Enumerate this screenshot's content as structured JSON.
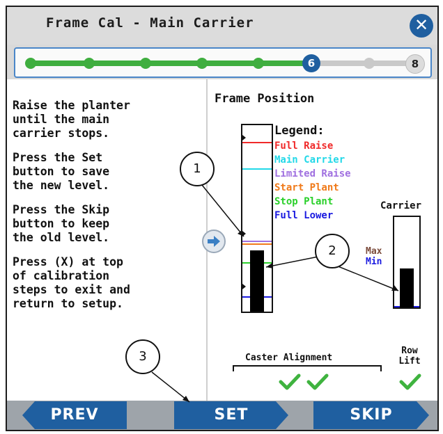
{
  "header": {
    "title": "Frame Cal - Main Carrier",
    "close_icon": "close-icon"
  },
  "progress": {
    "completed_steps": 5,
    "current_step": "6",
    "last_step": "8"
  },
  "instructions": [
    "Raise the planter\nuntil the main\ncarrier stops.",
    "Press the Set\nbutton to save\nthe new level.",
    "Press the Skip\nbutton to keep\nthe old level.",
    "Press (X) at top\nof calibration\nsteps to exit and\nreturn to setup."
  ],
  "frame_position": {
    "title": "Frame Position",
    "legend_title": "Legend:",
    "legend": [
      {
        "label": "Full Raise",
        "color": "#f02a2a"
      },
      {
        "label": "Main Carrier",
        "color": "#22d8e8"
      },
      {
        "label": "Limited Raise",
        "color": "#a070e0"
      },
      {
        "label": "Start Plant",
        "color": "#f07a1a"
      },
      {
        "label": "Stop Plant",
        "color": "#2ad02a"
      },
      {
        "label": "Full Lower",
        "color": "#1a1ae0"
      }
    ],
    "fill_fraction": 0.33
  },
  "carrier": {
    "label": "Carrier",
    "max_label": "Max",
    "min_label": "Min",
    "fill_fraction": 0.43
  },
  "status": {
    "caster_alignment_label": "Caster Alignment",
    "row_lift_label": "Row\nLift"
  },
  "footer": {
    "prev_label": "PREV",
    "set_label": "SET",
    "skip_label": "SKIP"
  },
  "callouts": [
    "1",
    "2",
    "3"
  ]
}
